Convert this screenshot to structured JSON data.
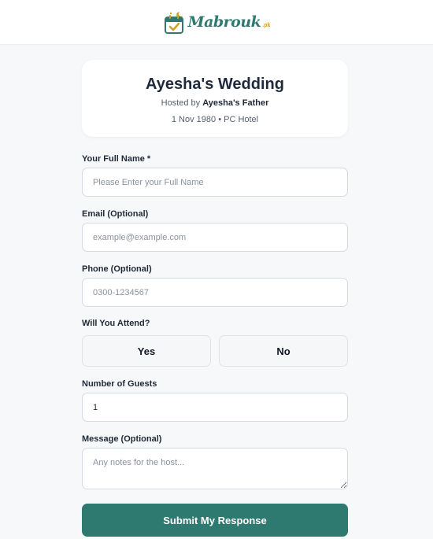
{
  "header": {
    "logo_text": "Mabrouk",
    "logo_tld": ".pk",
    "brand_color": "#2f7a70",
    "accent_color": "#c9a227",
    "logo_icon": "calendar-check-icon"
  },
  "event": {
    "title": "Ayesha's Wedding",
    "hosted_prefix": "Hosted by ",
    "host": "Ayesha's Father",
    "meta": "1 Nov 1980 • PC Hotel"
  },
  "form": {
    "name": {
      "label": "Your Full Name *",
      "placeholder": "Please Enter your Full Name",
      "value": ""
    },
    "email": {
      "label": "Email (Optional)",
      "placeholder": "example@example.com",
      "value": ""
    },
    "phone": {
      "label": "Phone (Optional)",
      "placeholder": "0300-1234567",
      "value": ""
    },
    "attend": {
      "label": "Will You Attend?",
      "yes": "Yes",
      "no": "No"
    },
    "guests": {
      "label": "Number of Guests",
      "value": "1"
    },
    "message": {
      "label": "Message (Optional)",
      "placeholder": "Any notes for the host...",
      "value": ""
    },
    "submit": "Submit My Response"
  }
}
